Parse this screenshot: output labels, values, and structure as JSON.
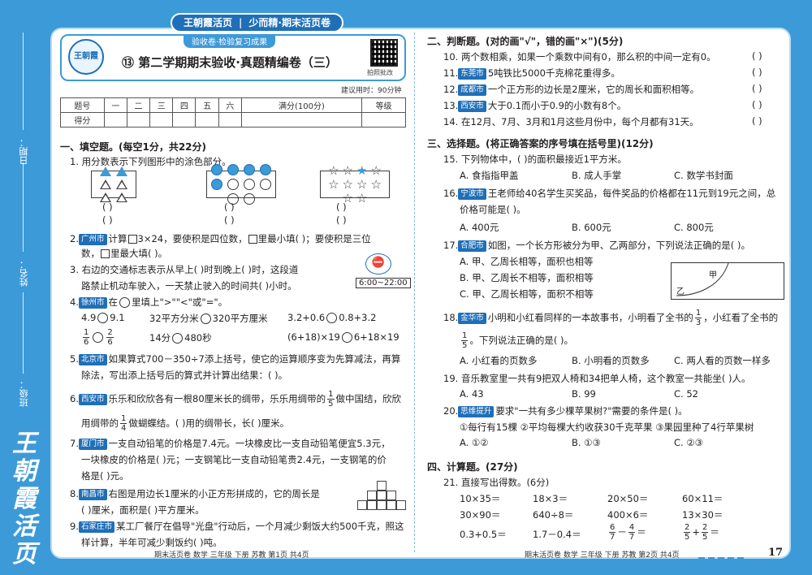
{
  "brand": {
    "banner_parts": [
      "王朝霞活页",
      "少而精·期末活页卷"
    ],
    "vertical": "王朝霞活页",
    "logo": "王朝霞"
  },
  "binding_labels": {
    "date": "日期：",
    "name": "姓名：",
    "class": "班级："
  },
  "header": {
    "subtitle": "验收卷·检验复习成果",
    "title": "⑬  第二学期期末验收·真题精编卷（三）",
    "qr_label": "拍照批改",
    "suggest_time": "建议用时：90分钟"
  },
  "score_table": {
    "row1": [
      "题号",
      "一",
      "二",
      "三",
      "四",
      "五",
      "六",
      "满分(100分)",
      "等级"
    ],
    "row2": [
      "得分",
      "",
      "",
      "",
      "",
      "",
      "",
      "",
      ""
    ]
  },
  "left": {
    "s1": "一、填空题。(每空1分，共22分)",
    "q1": "1. 用分数表示下列图形中的涂色部分。",
    "q2_tag": "广州市",
    "q2a": "计算",
    "q2b": "3×24，要使积是四位数，",
    "q2c": "里最小填(        )；要使积是三位",
    "q2d": "数，",
    "q2e": "里最大填(        )。",
    "q3a": "3. 右边的交通标志表示从早上(        )时到晚上(        )时，这段道",
    "q3b": "路禁止机动车驶入，一天禁止驶入的时间共(        )小时。",
    "sign_time": "6:00~22:00",
    "q4_tag": "徐州市",
    "q4a": "在",
    "q4b": "里填上\">\"\"<\"或\"=\"。",
    "c1a": "4.9",
    "c1b": "9.1",
    "c2a": "32平方分米",
    "c2b": "320平方厘米",
    "c3a": "3.2+0.6",
    "c3b": "0.8+3.2",
    "c4a": "6",
    "c4b": "480秒",
    "c4c": "14分",
    "c5a": "(6+18)×19",
    "c5b": "6+18×19",
    "q5_tag": "北京市",
    "q5a": "如果算式700－350÷7添上括号，使它的运算顺序变为先算减法，再算",
    "q5b": "除法，写出添上括号后的算式并计算出结果：(                              )。",
    "q6_tag": "西安市",
    "q6a": "乐乐和欣欣各有一根80厘米长的绸带，乐乐用绸带的",
    "q6b": "做中国结，欣欣",
    "q6c": "用绸带的",
    "q6d": "做蝴蝶结。(        )用的绸带长，长(        )厘米。",
    "q7_tag": "厦门市",
    "q7a": "一支自动铅笔的价格是7.4元。一块橡皮比一支自动铅笔便宜5.3元，",
    "q7b": "一块橡皮的价格是(        )元；一支钢笔比一支自动铅笔贵2.4元，一支钢笔的价",
    "q7c": "格是(        )元。",
    "q8_tag": "南昌市",
    "q8a": "右图是用边长1厘米的小正方形拼成的，它的周长是",
    "q8b": "(        )厘米，面积是(        )平方厘米。",
    "q9_tag": "石家庄市",
    "q9a": "某工厂餐厅在倡导\"光盘\"行动后，一个月减少剩饭大约500千克，照这",
    "q9b": "样计算，半年可减少剩饭约(        )吨。"
  },
  "right": {
    "s2": "二、判断题。(对的画\"√\"，错的画\"×\")(5分)",
    "j10": "10. 两个数相乘，如果一个乘数中间有0，那么积的中间一定有0。",
    "j11_tag": "东莞市",
    "j11": "5吨铁比5000千克棉花重得多。",
    "j12_tag": "成都市",
    "j12": "一个正方形的边长是2厘米，它的周长和面积相等。",
    "j13_tag": "西安市",
    "j13": "大于0.1而小于0.9的小数有8个。",
    "j14": "14. 在12月、7月、3月和1月这些月份中，每个月都有31天。",
    "paren": "(        )",
    "s3": "三、选择题。(将正确答案的序号填在括号里)(12分)",
    "c15": "15. 下列物体中，(        )的面积最接近1平方米。",
    "c15o": [
      "A. 食指指甲盖",
      "B. 成人手掌",
      "C. 数学书封面"
    ],
    "c16_tag": "宁波市",
    "c16a": "王老师给40名学生买奖品，每件奖品的价格都在11元到19元之间，总",
    "c16b": "价格可能是(        )。",
    "c16o": [
      "A. 400元",
      "B. 600元",
      "C. 800元"
    ],
    "c17_tag": "合肥市",
    "c17a": "如图，一个长方形被分为甲、乙两部分，下列说法正确的是(        )。",
    "c17o": [
      "A. 甲、乙周长相等，面积也相等",
      "B. 甲、乙周长不相等，面积相等",
      "C. 甲、乙周长相等，面积不相等"
    ],
    "fig_jia": "甲",
    "fig_yi": "乙",
    "c18_tag": "金华市",
    "c18a": "小明和小红看同样的一本故事书，小明看了全书的",
    "c18b": "，小红看了全书的",
    "c18c": "。下列说法正确的是(        )。",
    "c18o": [
      "A. 小红看的页数多",
      "B. 小明看的页数多",
      "C. 两人看的页数一样多"
    ],
    "c19": "19. 音乐教室里一共有9把双人椅和34把单人椅，这个教室一共能坐(        )人。",
    "c19o": [
      "A. 43",
      "B. 99",
      "C. 52"
    ],
    "c20_tag": "思维提升",
    "c20a": "要求\"一共有多少棵苹果树?\"需要的条件是(        )。",
    "c20b": "①每行有15棵    ②平均每棵大约收获30千克苹果    ③果园里种了4行苹果树",
    "c20o": [
      "A. ①②",
      "B. ①③",
      "C. ②③"
    ],
    "s4": "四、计算题。(27分)",
    "q21": "21. 直接写出得数。(6分)",
    "calc": [
      [
        "10×35＝",
        "18×3＝",
        "20×50＝",
        "60×11＝"
      ],
      [
        "30×90＝",
        "640÷8＝",
        "400×6＝",
        "13×30＝"
      ],
      [
        "0.3+0.5＝",
        "1.7－0.4＝",
        "",
        ""
      ]
    ]
  },
  "footer": {
    "left": "期末活页卷  数学  三年级  下册  苏教  第1页  共4页",
    "right": "期末活页卷  数学  三年级  下册  苏教  第2页  共4页",
    "page": "17"
  }
}
